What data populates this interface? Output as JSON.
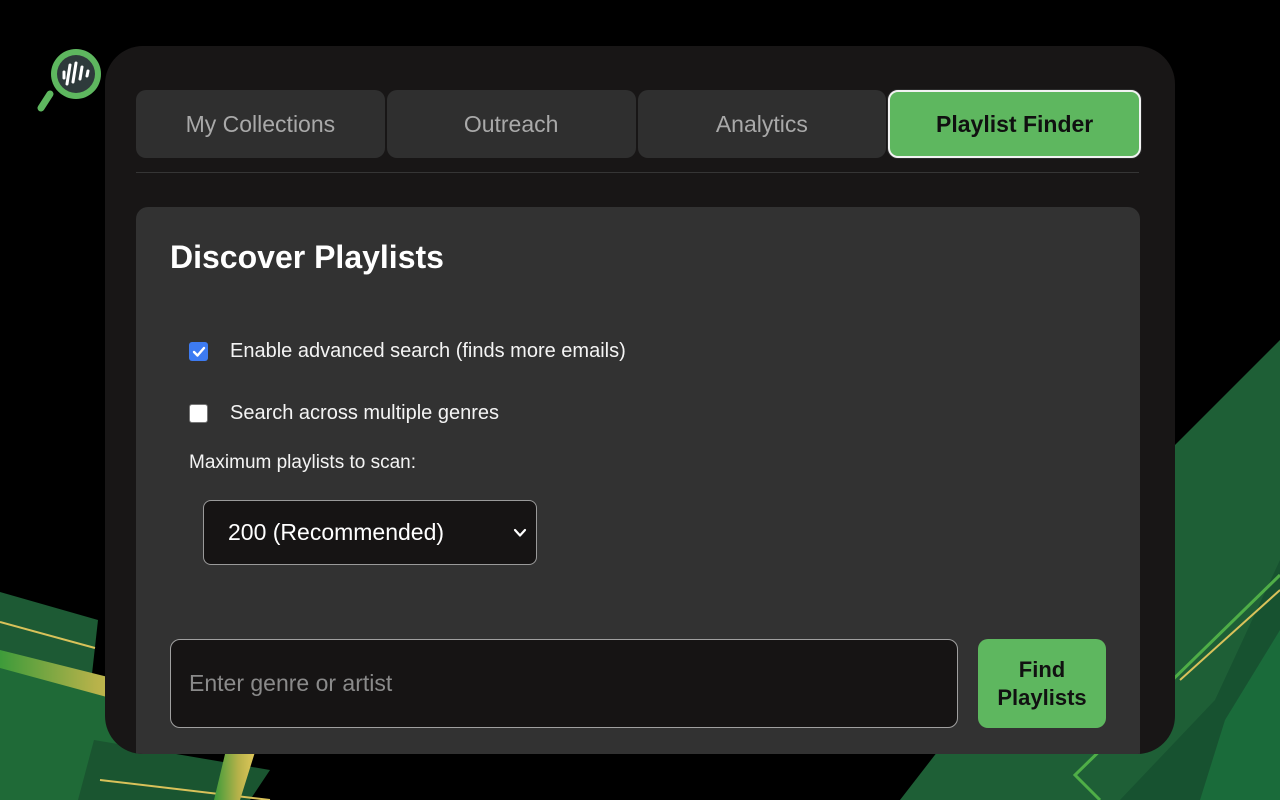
{
  "tabs": [
    {
      "label": "My Collections",
      "active": false
    },
    {
      "label": "Outreach",
      "active": false
    },
    {
      "label": "Analytics",
      "active": false
    },
    {
      "label": "Playlist Finder",
      "active": true
    }
  ],
  "discover": {
    "title": "Discover Playlists",
    "options": [
      {
        "label": "Enable advanced search (finds more emails)",
        "checked": true
      },
      {
        "label": "Search across multiple genres",
        "checked": false
      }
    ],
    "max_scan_label": "Maximum playlists to scan:",
    "max_scan_value": "200 (Recommended)",
    "search_placeholder": "Enter genre or artist",
    "search_value": "",
    "find_button": "Find Playlists"
  },
  "icons": {
    "logo": "magnifier-soundwave-icon",
    "select_arrow": "chevron-down-icon",
    "check": "checkmark-icon"
  },
  "colors": {
    "accent": "#5eb75f",
    "checkbox": "#3d7bf2",
    "panel": "#181616",
    "card": "#323232",
    "background_art": "#1d5a34"
  }
}
